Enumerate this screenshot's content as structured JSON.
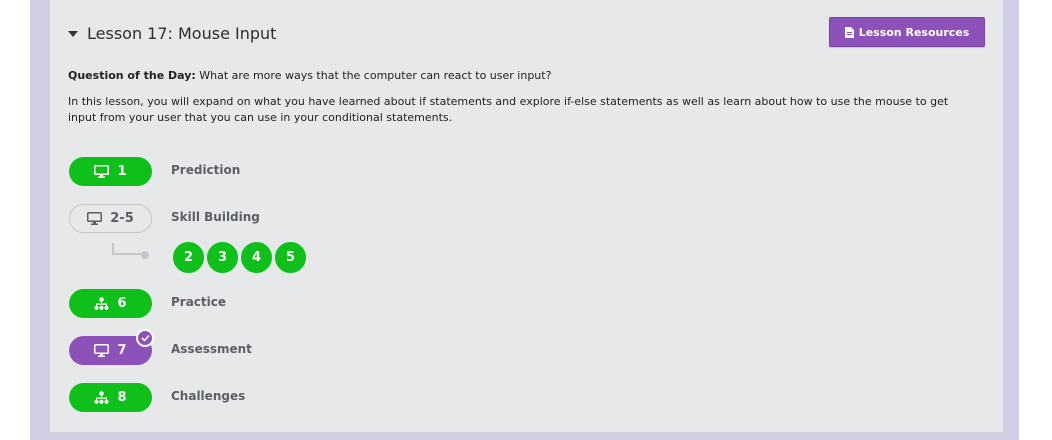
{
  "lesson": {
    "title": "Lesson 17: Mouse Input",
    "resources_label": "Lesson Resources",
    "qotd_label": "Question of the Day:",
    "qotd_text": " What are more ways that the computer can react to user input?",
    "description": "In this lesson, you will expand on what you have learned about if statements and explore if-else statements as well as learn about how to use the mouse to get input from your user that you can use in your conditional statements."
  },
  "levels": [
    {
      "number": "1",
      "label": "Prediction",
      "icon": "monitor-icon",
      "style": "green"
    },
    {
      "number": "2-5",
      "label": "Skill Building",
      "icon": "monitor-icon",
      "style": "outline"
    },
    {
      "number": "6",
      "label": "Practice",
      "icon": "hierarchy-icon",
      "style": "green"
    },
    {
      "number": "7",
      "label": "Assessment",
      "icon": "monitor-icon",
      "style": "purple",
      "completed": true
    },
    {
      "number": "8",
      "label": "Challenges",
      "icon": "hierarchy-icon",
      "style": "green"
    }
  ],
  "sublevels": [
    "2",
    "3",
    "4",
    "5"
  ],
  "colors": {
    "green": "#0fbf1a",
    "purple": "#8c52ba",
    "card_bg": "#e7e8ea",
    "page_bg": "#d1cde3"
  }
}
